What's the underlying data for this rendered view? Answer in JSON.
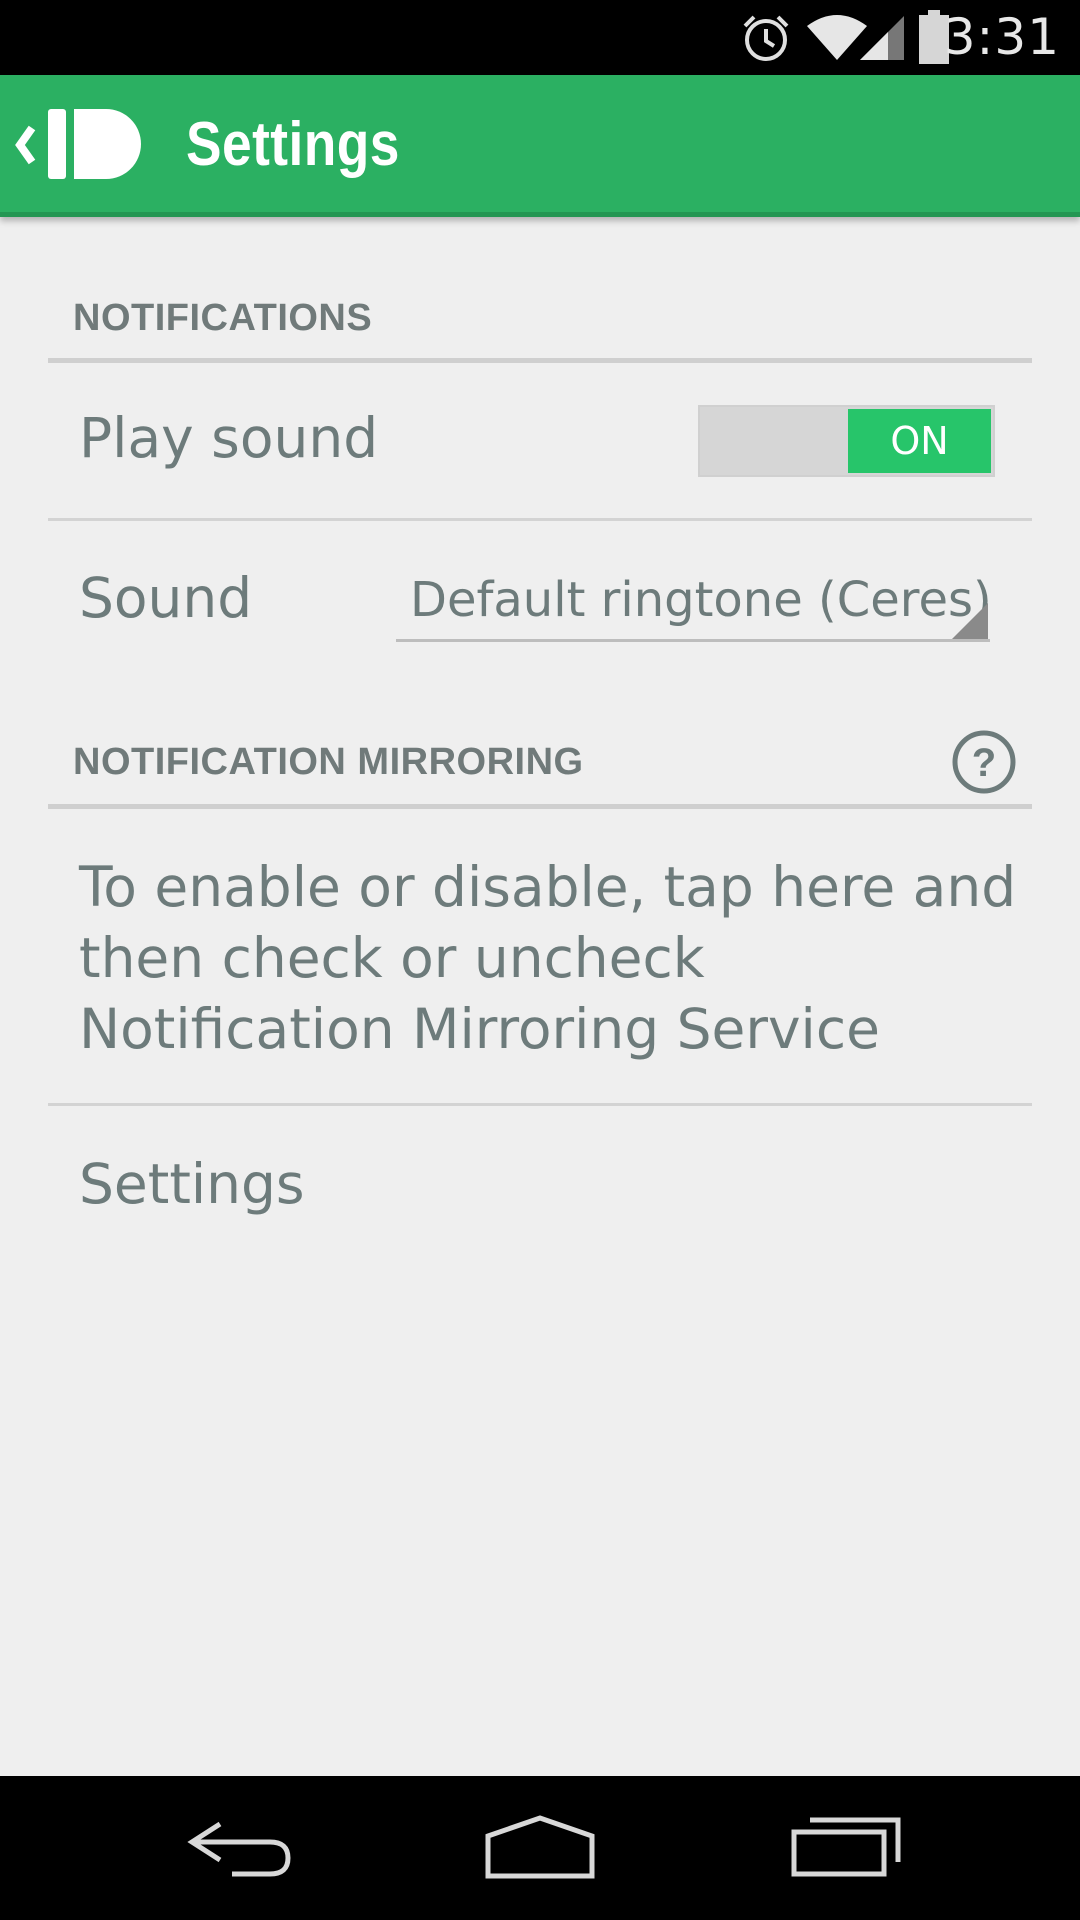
{
  "status_bar": {
    "time": "3:31",
    "icons": [
      "alarm-icon",
      "wifi-icon",
      "signal-icon",
      "battery-icon"
    ]
  },
  "action_bar": {
    "title": "Settings",
    "logo_icon": "pushbullet-logo-icon",
    "background_color": "#2bb062"
  },
  "sections": {
    "notifications": {
      "header": "NOTIFICATIONS",
      "play_sound": {
        "label": "Play sound",
        "toggle_state": "ON",
        "accent_color": "#27c56a"
      },
      "sound": {
        "label": "Sound",
        "selected_value": "Default ringtone (Ceres)"
      }
    },
    "notification_mirroring": {
      "header": "NOTIFICATION MIRRORING",
      "help_icon": "question-mark-icon",
      "description": "To enable or disable, tap here and then check or uncheck Notification Mirroring Service",
      "settings_label": "Settings"
    }
  },
  "nav_bar": {
    "buttons": [
      "back-icon",
      "home-icon",
      "recents-icon"
    ]
  }
}
